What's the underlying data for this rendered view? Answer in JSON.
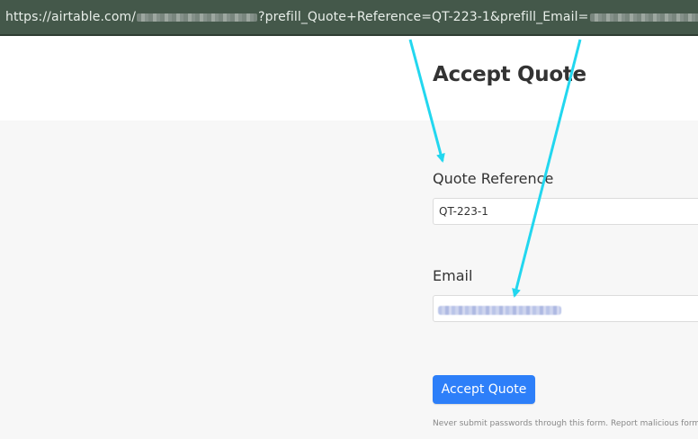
{
  "browser": {
    "url_prefix": "https://airtable.com/",
    "url_middle": "?prefill_Quote+Reference=QT-223-1&prefill_Email="
  },
  "form": {
    "title": "Accept Quote",
    "fields": [
      {
        "label": "Quote Reference",
        "value": "QT-223-1"
      },
      {
        "label": "Email",
        "value": ""
      }
    ],
    "submit_label": "Accept Quote",
    "footer_text": "Never submit passwords through this form.",
    "report_link": "Report malicious form"
  },
  "colors": {
    "url_bar": "#44584a",
    "submit_button": "#2d7ff9",
    "annotation_arrow": "#22d7ef"
  },
  "annotations": {
    "arrows": [
      "arrow-to-quote-reference",
      "arrow-to-email"
    ]
  }
}
